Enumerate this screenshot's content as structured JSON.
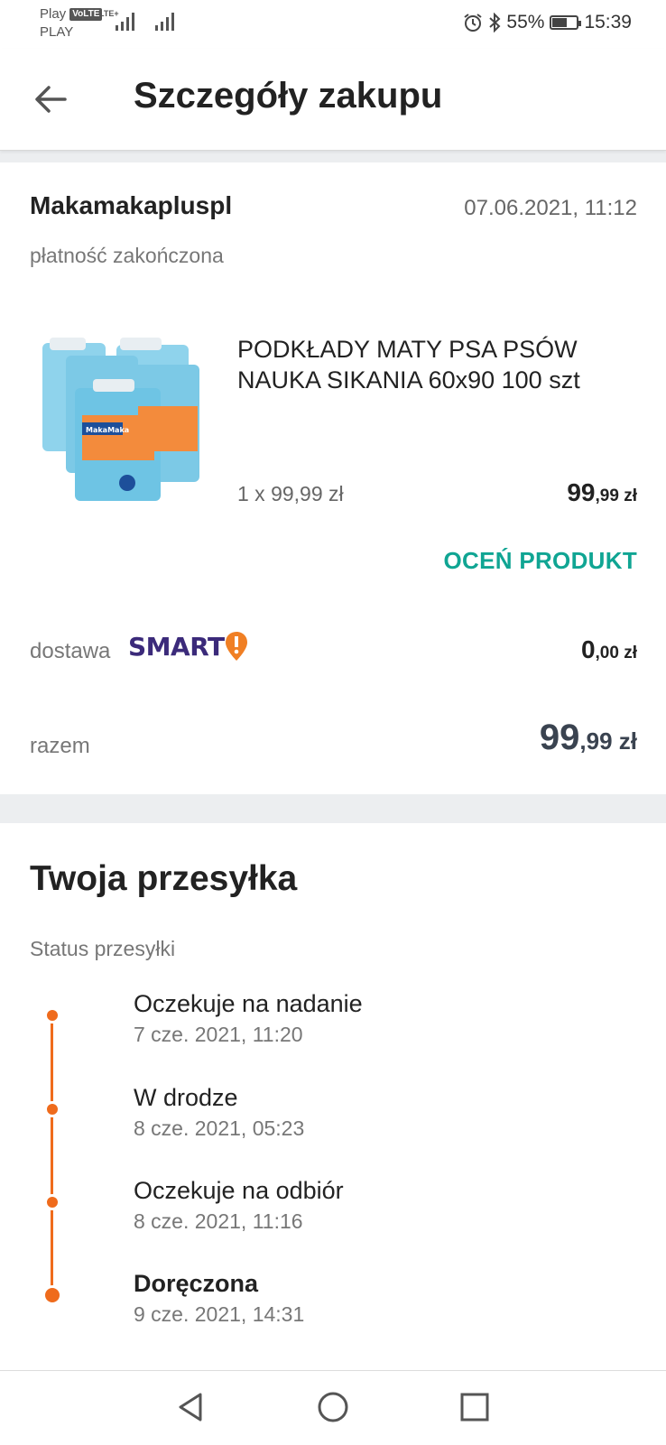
{
  "status_bar": {
    "carrier1": "Play",
    "carrier2": "PLAY",
    "volte": "VoLTE",
    "lte": "LTE+",
    "battery": "55%",
    "time": "15:39"
  },
  "header": {
    "title": "Szczegóły zakupu"
  },
  "order": {
    "seller": "Makamakapluspl",
    "date": "07.06.2021, 11:12",
    "payment_status": "płatność zakończona",
    "product": {
      "title": "PODKŁADY MATY PSA PSÓW NAUKA SIKANIA 60x90 100 szt",
      "quantity_line": "1 x 99,99 zł",
      "price_main": "99",
      "price_fraction": ",99 zł"
    },
    "rate_button": "OCEŃ PRODUKT",
    "delivery_label": "dostawa",
    "delivery_badge": "SMART",
    "delivery_price_main": "0",
    "delivery_price_fraction": ",00 zł",
    "total_label": "razem",
    "total_main": "99",
    "total_fraction": ",99 zł"
  },
  "shipment": {
    "title": "Twoja przesyłka",
    "status_label": "Status przesyłki",
    "events": [
      {
        "title": "Oczekuje na nadanie",
        "date": "7 cze. 2021, 11:20"
      },
      {
        "title": "W drodze",
        "date": "8 cze. 2021, 05:23"
      },
      {
        "title": "Oczekuje na odbiór",
        "date": "8 cze. 2021, 11:16"
      },
      {
        "title": "Doręczona",
        "date": "9 cze. 2021, 14:31"
      }
    ]
  },
  "colors": {
    "accent_teal": "#10a593",
    "timeline_orange": "#ef6b1c",
    "smart_purple": "#3b2a7a"
  },
  "icons": {
    "back": "arrow-left-icon",
    "nav_back": "triangle-back-icon",
    "nav_home": "circle-home-icon",
    "nav_recent": "square-recents-icon"
  }
}
